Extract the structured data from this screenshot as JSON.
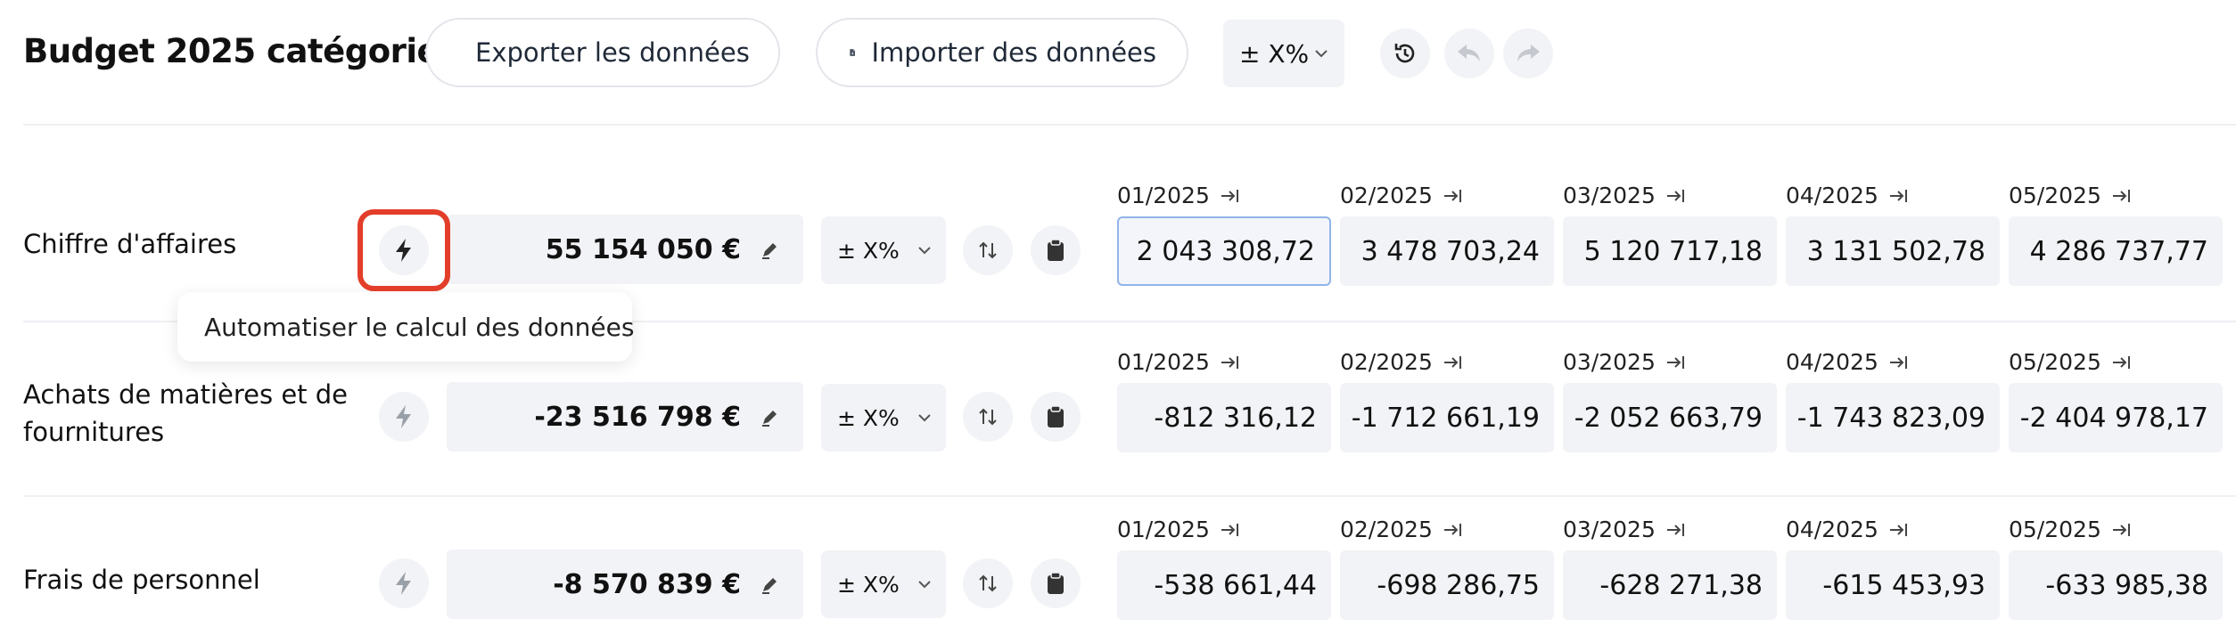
{
  "header": {
    "title": "Budget 2025 catégorie",
    "export_label": "Exporter les données",
    "import_label": "Importer des données",
    "variation_label": "± X%"
  },
  "tooltip": "Automatiser le calcul des données",
  "rows": [
    {
      "category": "Chiffre d'affaires",
      "total": "55 154 050 €",
      "variation": "± X%",
      "months": [
        {
          "label": "01/2025",
          "value": "2 043 308,72"
        },
        {
          "label": "02/2025",
          "value": "3 478 703,24"
        },
        {
          "label": "03/2025",
          "value": "5 120 717,18"
        },
        {
          "label": "04/2025",
          "value": "3 131 502,78"
        },
        {
          "label": "05/2025",
          "value": "4 286 737,77"
        }
      ]
    },
    {
      "category": "Achats de matières et de fournitures",
      "total": "-23 516 798 €",
      "variation": "± X%",
      "months": [
        {
          "label": "01/2025",
          "value": "-812 316,12"
        },
        {
          "label": "02/2025",
          "value": "-1 712 661,19"
        },
        {
          "label": "03/2025",
          "value": "-2 052 663,79"
        },
        {
          "label": "04/2025",
          "value": "-1 743 823,09"
        },
        {
          "label": "05/2025",
          "value": "-2 404 978,17"
        }
      ]
    },
    {
      "category": "Frais de personnel",
      "total": "-8 570 839 €",
      "variation": "± X%",
      "months": [
        {
          "label": "01/2025",
          "value": "-538 661,44"
        },
        {
          "label": "02/2025",
          "value": "-698 286,75"
        },
        {
          "label": "03/2025",
          "value": "-628 271,38"
        },
        {
          "label": "04/2025",
          "value": "-615 453,93"
        },
        {
          "label": "05/2025",
          "value": "-633 985,38"
        }
      ]
    }
  ],
  "colors": {
    "highlight": "#e23e2a",
    "focus_border": "#8fb4ea",
    "cell_bg": "#f2f3f6"
  }
}
